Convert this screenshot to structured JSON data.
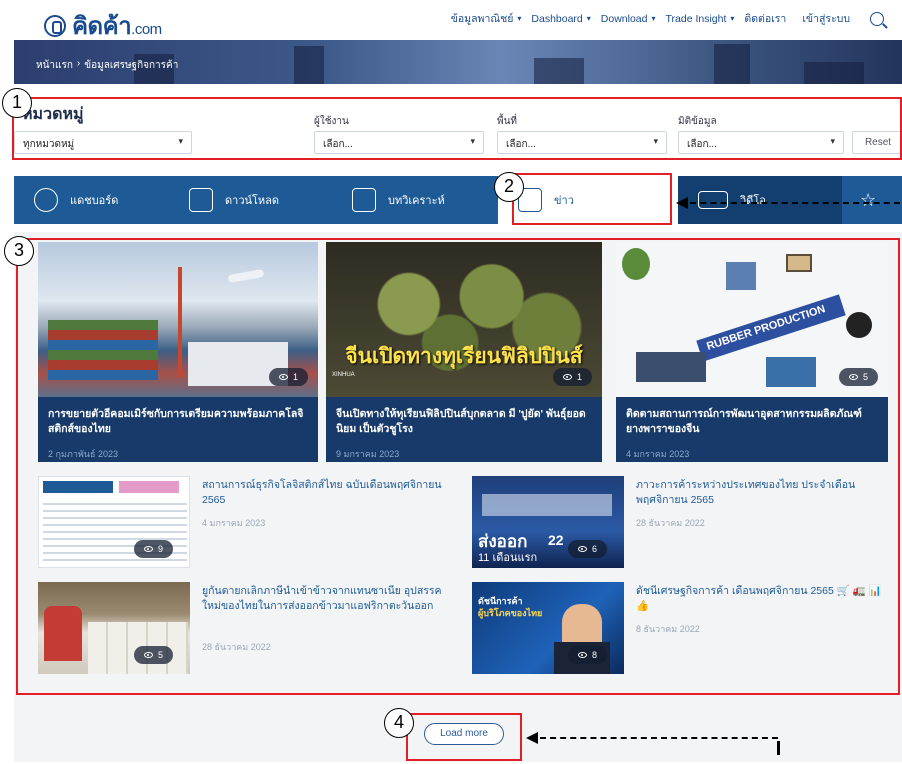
{
  "header": {
    "logo_text": "คิดค้า",
    "logo_suffix": ".com",
    "nav": [
      {
        "label": "ข้อมูลพาณิชย์",
        "caret": true
      },
      {
        "label": "Dashboard",
        "caret": true
      },
      {
        "label": "Download",
        "caret": true
      },
      {
        "label": "Trade Insight",
        "caret": true
      },
      {
        "label": "ติดต่อเรา",
        "caret": false
      },
      {
        "label": "เข้าสู่ระบบ",
        "caret": false
      }
    ]
  },
  "breadcrumb": {
    "home": "หน้าแรก",
    "sep": "›",
    "current": "ข้อมูลเศรษฐกิจการค้า"
  },
  "filter": {
    "title": "หมวดหมู่",
    "category_value": "ทุกหมวดหมู่",
    "user_label": "ผู้ใช้งาน",
    "user_value": "เลือก...",
    "area_label": "พื้นที่",
    "area_value": "เลือก...",
    "dimension_label": "มิติข้อมูล",
    "dimension_value": "เลือก...",
    "reset_label": "Reset"
  },
  "tabs": [
    {
      "label": "แดชบอร์ด",
      "icon": "dashboard-gauge-icon"
    },
    {
      "label": "ดาวน์โหลด",
      "icon": "download-list-icon"
    },
    {
      "label": "บทวิเคราะห์",
      "icon": "analysis-document-icon"
    },
    {
      "label": "ข่าว",
      "icon": "news-icon"
    },
    {
      "label": "วิดีโอ",
      "icon": "video-film-icon"
    },
    {
      "label": "",
      "icon": "star-icon"
    }
  ],
  "featured": [
    {
      "title": "การขยายตัวอีคอมเมิร์ซกับการเตรียมความพร้อมภาคโลจิสติกส์ของไทย",
      "date": "2 กุมภาพันธ์ 2023",
      "views": "1"
    },
    {
      "title": "จีนเปิดทางให้ทุเรียนฟิลิปปินส์บุกตลาด มี 'ปูยัด' พันธุ์ยอดนิยม เป็นตัวชูโรง",
      "date": "9 มกราคม 2023",
      "views": "1",
      "overlay": "จีนเปิดทางทุเรียนฟิลิปปินส์",
      "watermark": "XINHUA"
    },
    {
      "title": "ติดตามสถานการณ์การพัฒนาอุตสาหกรรมผลิตภัณฑ์ยางพาราของจีน",
      "date": "4 มกราคม 2023",
      "views": "5",
      "overlay": "RUBBER PRODUCTION"
    }
  ],
  "list": [
    {
      "title": "สถานการณ์ธุรกิจโลจิสติกส์ไทย ฉบับเดือนพฤศจิกายน 2565",
      "date": "4 มกราคม 2023",
      "views": "9"
    },
    {
      "title": "ภาวะการค้าระหว่างประเทศของไทย ประจำเดือนพฤศจิกายน 2565",
      "date": "28 ธันวาคม 2022",
      "views": "6",
      "overlay_a": "ส่งออก",
      "overlay_b": "11 เดือนแรก",
      "overlay_c": "22"
    },
    {
      "title": "ยูกันดายกเลิกภาษีนำเข้าข้าวจากแทนซาเนีย อุปสรรคใหม่ของไทยในการส่งออกข้าวมาแอฟริกาตะวันออก",
      "date": "28 ธันวาคม 2022",
      "views": "5"
    },
    {
      "title": "ดัชนีเศรษฐกิจการค้า เดือนพฤศจิกายน 2565 🛒 🚛 📊 👍",
      "date": "8 ธันวาคม 2022",
      "views": "8",
      "overlay_a": "ดัชนีการค้า",
      "overlay_b": "ผู้บริโภคของไทย"
    }
  ],
  "load_more": "Load more",
  "annotations": [
    "1",
    "2",
    "3",
    "4"
  ],
  "colors": {
    "brand": "#1a4b8f",
    "tab_bar": "#1d5a96",
    "card_bg": "#173a6b",
    "annotation_red": "#e41e26"
  }
}
